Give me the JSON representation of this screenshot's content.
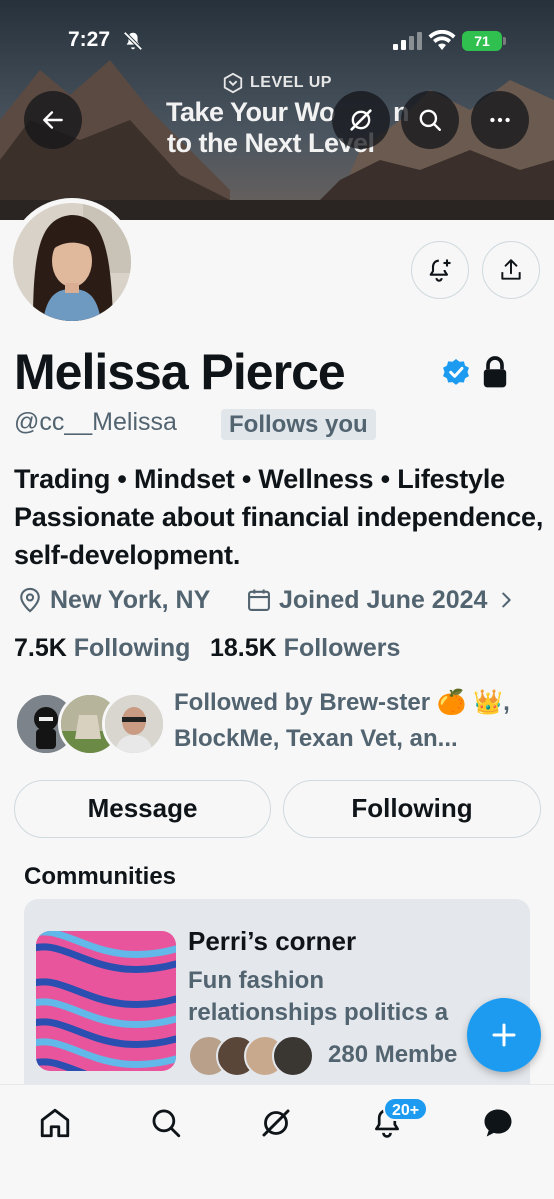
{
  "status_bar": {
    "time": "7:27",
    "battery": "71"
  },
  "banner_ad": {
    "brand": "LEVEL UP",
    "line1": "Take Your Wo",
    "line1_tail": "n",
    "line2": "to the Next Level"
  },
  "profile": {
    "name": "Melissa Pierce",
    "handle": "@cc__Melissa",
    "follows_you": "Follows you",
    "bio": "Trading • Mindset • Wellness • Lifestyle Passionate about financial independence, self-development.",
    "location": "New York, NY",
    "joined": "Joined June 2024",
    "following_count": "7.5K",
    "following_label": "Following",
    "followers_count": "18.5K",
    "followers_label": "Followers",
    "followed_by": "Followed by Brew-ster 🍊 👑, BlockMe, Texan Vet, an..."
  },
  "actions": {
    "message": "Message",
    "following": "Following"
  },
  "communities": {
    "title": "Communities",
    "items": [
      {
        "name": "Perri’s corner",
        "desc_line1": "Fun fashion",
        "desc_line2": "relationships politics a",
        "members": "280 Membe"
      }
    ]
  },
  "tabbar": {
    "notifications_badge": "20+"
  },
  "colors": {
    "accent": "#1d9bf0",
    "secondary_text": "#536471",
    "primary_text": "#0f1419"
  }
}
